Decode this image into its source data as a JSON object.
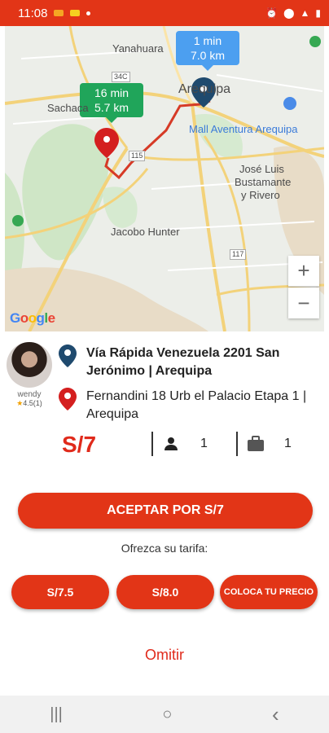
{
  "status_bar": {
    "time": "11:08",
    "indicator_colors": [
      "#f5a623",
      "#f5d020",
      "#ffffff"
    ]
  },
  "map": {
    "bubble_blue": {
      "time": "1 min",
      "distance": "7.0 km"
    },
    "bubble_green": {
      "time": "16 min",
      "distance": "5.7 km"
    },
    "places": {
      "yanahuara": "Yanahuara",
      "arequipa": "Arequipa",
      "sachaca": "Sachaca",
      "mall": "Mall Aventura Arequipa",
      "bustamante_1": "José Luis",
      "bustamante_2": "Bustamante",
      "bustamante_3": "y Rivero",
      "hunter": "Jacobo Hunter"
    },
    "road_badges": {
      "r34c": "34C",
      "r115": "115",
      "r117": "117"
    },
    "zoom_in": "+",
    "zoom_out": "−",
    "google": "Google"
  },
  "rider": {
    "name": "wendy",
    "rating": "4.5(1)"
  },
  "pickup": {
    "address": "Vía Rápida Venezuela 2201 San Jerónimo | Arequipa"
  },
  "dropoff": {
    "address": "Fernandini 18 Urb el Palacio Etapa 1 | Arequipa"
  },
  "trip": {
    "price": "S/7",
    "passengers": "1",
    "luggage": "1"
  },
  "actions": {
    "accept": "ACEPTAR POR S/7",
    "offer_label": "Ofrezca su tarifa:",
    "tariffs": [
      "S/7.5",
      "S/8.0",
      "COLOCA TU PRECIO"
    ],
    "skip": "Omitir"
  },
  "nav_bar": {
    "recents": "|||",
    "home": "○",
    "back": "‹"
  },
  "colors": {
    "accent": "#e23517",
    "price": "#e02a1b",
    "pickup_pin": "#1f4a6e",
    "dropoff_pin": "#d41f1f"
  }
}
